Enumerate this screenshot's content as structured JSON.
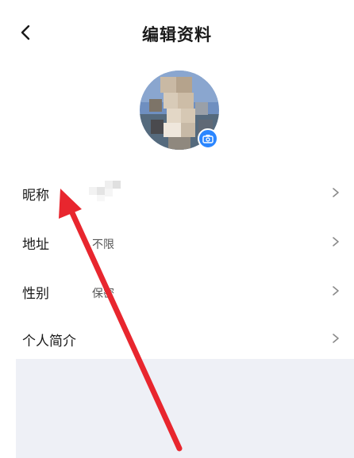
{
  "header": {
    "title": "编辑资料",
    "back_icon": "chevron-left-icon"
  },
  "profile": {
    "avatar_alt": "",
    "camera_icon": "camera-icon"
  },
  "fields": [
    {
      "label": "昵称",
      "value": ""
    },
    {
      "label": "地址",
      "value": "不限"
    },
    {
      "label": "性别",
      "value": "保密"
    },
    {
      "label": "个人简介",
      "value": ""
    }
  ],
  "colors": {
    "accent": "#2b86ff",
    "annotation_arrow": "#e8262e",
    "panel_bg": "#eef0f6"
  }
}
